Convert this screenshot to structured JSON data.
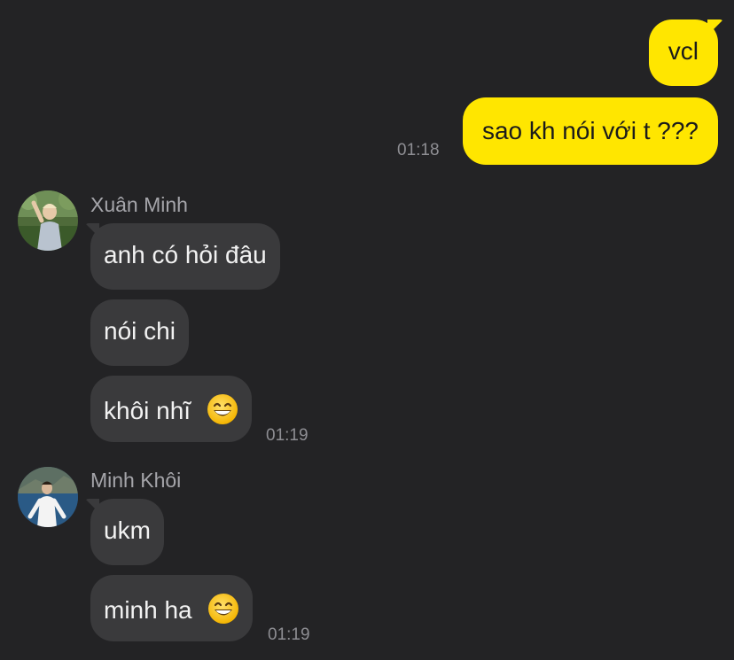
{
  "conversation": {
    "outgoing": [
      {
        "text": "vcl"
      },
      {
        "text": "sao kh nói với t ???",
        "time": "01:18"
      }
    ],
    "groups": [
      {
        "sender": "Xuân Minh",
        "messages": [
          {
            "text": "anh có hỏi đâu"
          },
          {
            "text": "nói chi"
          },
          {
            "text": "khôi nhĩ",
            "emoji": "grinning-face-with-smiling-eyes",
            "time": "01:19"
          }
        ]
      },
      {
        "sender": "Minh Khôi",
        "messages": [
          {
            "text": "ukm"
          },
          {
            "text": "minh ha",
            "emoji": "grinning-face-with-smiling-eyes",
            "time": "01:19"
          }
        ]
      }
    ]
  },
  "colors": {
    "background": "#232325",
    "outgoing_bubble": "#ffe600",
    "incoming_bubble": "#3a3a3c",
    "timestamp": "#8e8e93"
  }
}
